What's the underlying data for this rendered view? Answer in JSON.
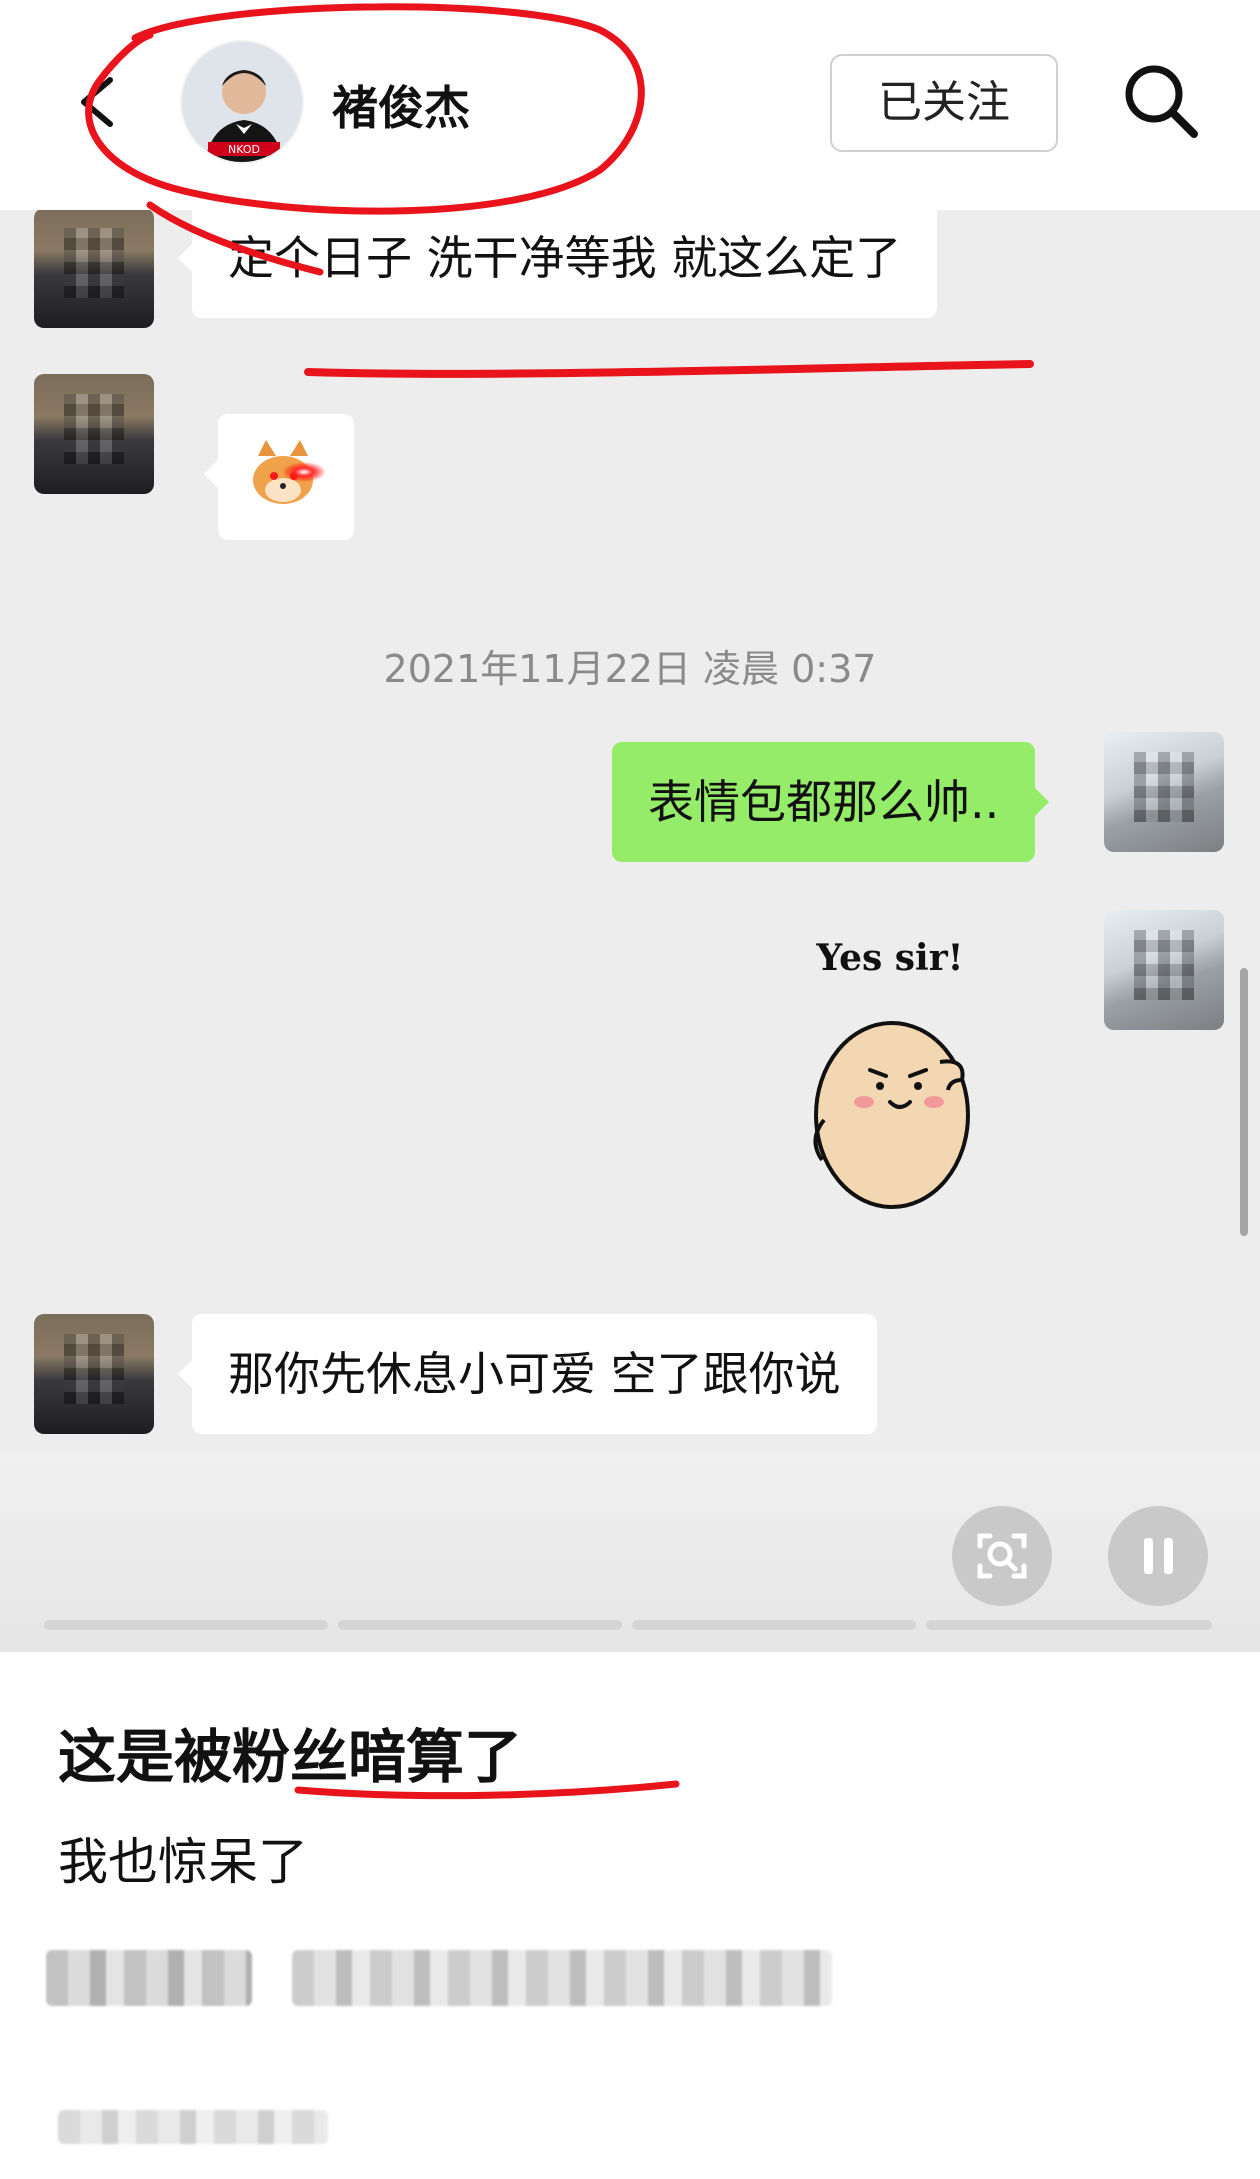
{
  "colors": {
    "chat_background": "#ededed",
    "sent_bubble": "#95ec69",
    "received_bubble": "#ffffff",
    "annotation_red": "#e8131b"
  },
  "header": {
    "back_icon": "chevron-left-icon",
    "contact_name": "褚俊杰",
    "avatar_badge": "NKOD",
    "follow_label": "已关注",
    "search_icon": "search-icon"
  },
  "chat": {
    "messages": [
      {
        "side": "left",
        "type": "text",
        "text": "定个日子 洗干净等我 就这么定了"
      },
      {
        "side": "left",
        "type": "sticker",
        "sticker": "shiba-laser-eyes-sticker"
      },
      {
        "side": "left",
        "type": "text",
        "text": "那你先休息小可爱 空了跟你说"
      }
    ],
    "timestamp": "2021年11月22日 凌晨 0:37",
    "sent": [
      {
        "type": "text",
        "text": "表情包都那么帅.."
      },
      {
        "type": "sticker",
        "sticker_caption": "Yes sir!"
      }
    ]
  },
  "controls": {
    "scan_icon": "scan-icon",
    "pause_icon": "pause-icon",
    "progress_segments": 4
  },
  "post": {
    "title": "这是被粉丝暗算了",
    "subtitle": "我也惊呆了"
  }
}
